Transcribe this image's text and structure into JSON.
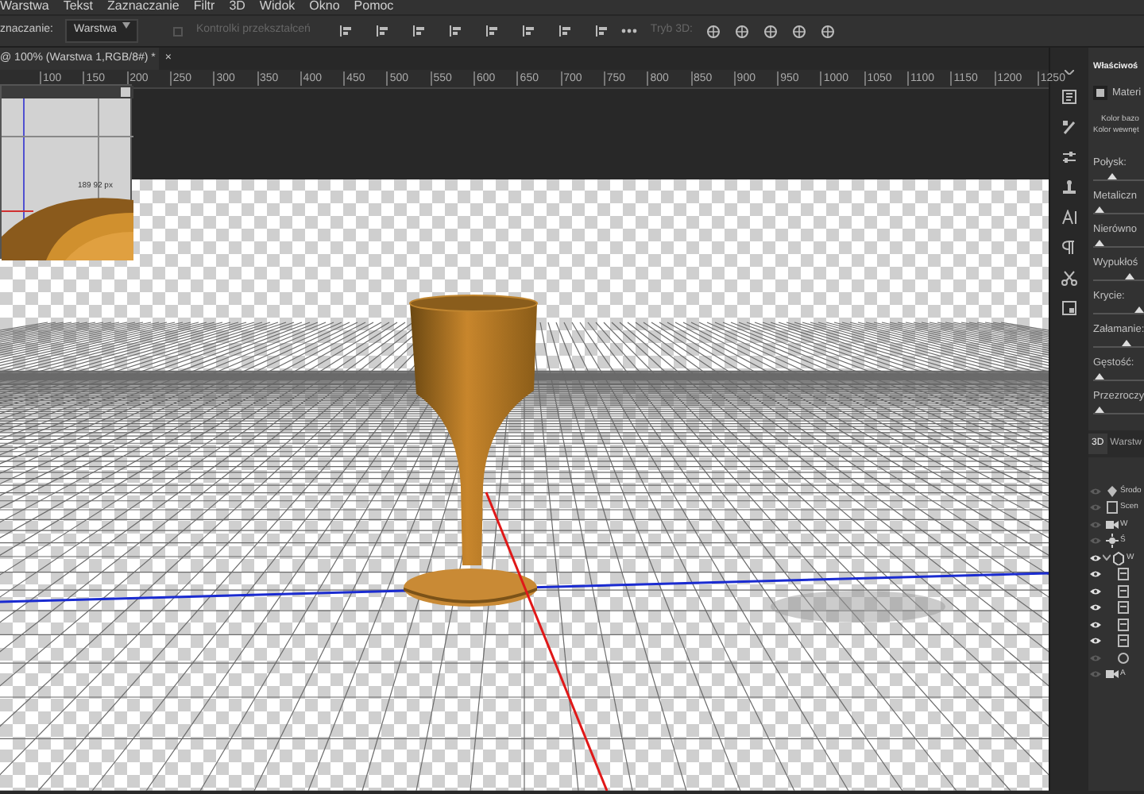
{
  "menu": [
    "Warstwa",
    "Tekst",
    "Zaznaczanie",
    "Filtr",
    "3D",
    "Widok",
    "Okno",
    "Pomoc"
  ],
  "options_bar": {
    "select_label": "znaczanie:",
    "select_value": "Warstwa",
    "transform_controls": {
      "label": "Kontrolki przekształceń",
      "checked": false,
      "disabled": true
    },
    "mode_label": "Tryb 3D:"
  },
  "document_tab": {
    "title": "@ 100% (Warstwa 1,RGB/8#) *",
    "close": "×"
  },
  "ruler": [
    "100",
    "150",
    "200",
    "250",
    "300",
    "350",
    "400",
    "450",
    "500",
    "550",
    "600",
    "650",
    "700",
    "750",
    "800",
    "850",
    "900",
    "950",
    "1000",
    "1050",
    "1100",
    "1150",
    "1200",
    "1250"
  ],
  "camera_view": {
    "readout": "189 92 px"
  },
  "properties": {
    "title": "Właściwoś",
    "material_tab": "Materi",
    "base_color": "Kolor bazo",
    "inner_color": "Kolor wewnęt",
    "sliders": [
      {
        "label": "Połysk:",
        "level": 0.35
      },
      {
        "label": "Metaliczn",
        "level": 0.05
      },
      {
        "label": "Nierówno",
        "level": 0.05
      },
      {
        "label": "Wypukłoś",
        "level": 0.75
      },
      {
        "label": "Krycie:",
        "level": 1
      },
      {
        "label": "Załamanie:",
        "level": 0.68
      },
      {
        "label": "Gęstość:",
        "level": 0.05
      },
      {
        "label": "Przezroczy",
        "level": 0.05
      }
    ]
  },
  "layers_panel": {
    "tabs": [
      {
        "label": "3D",
        "selected": true
      },
      {
        "label": "Warstw",
        "selected": false
      }
    ],
    "items": [
      {
        "kind": "environment",
        "name": "Środo",
        "visible": false
      },
      {
        "kind": "scene",
        "name": "Scen",
        "visible": false
      },
      {
        "kind": "camera",
        "name": "W",
        "visible": false
      },
      {
        "kind": "light",
        "name": "Ś",
        "visible": false
      },
      {
        "kind": "mesh",
        "name": "W",
        "visible": true,
        "expanded": true,
        "children": [
          {
            "kind": "material",
            "visible": true
          },
          {
            "kind": "material",
            "visible": true
          },
          {
            "kind": "material",
            "visible": true
          },
          {
            "kind": "material",
            "visible": true
          },
          {
            "kind": "material",
            "visible": true
          },
          {
            "kind": "sphere",
            "visible": false
          }
        ]
      },
      {
        "kind": "camera",
        "name": "A",
        "visible": false
      }
    ]
  }
}
